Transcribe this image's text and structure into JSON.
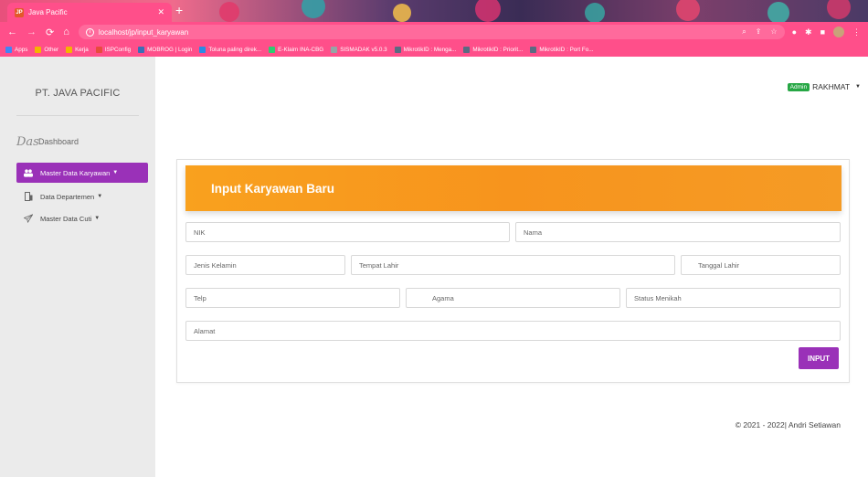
{
  "browser": {
    "tab_title": "Java Pacific",
    "tab_favicon_text": "JP",
    "url": "localhost/jp/input_karyawan",
    "bookmarks": [
      {
        "label": "Apps",
        "color": "#4285f4"
      },
      {
        "label": "Other",
        "color": "#f4b400"
      },
      {
        "label": "Kerja",
        "color": "#f4b400"
      },
      {
        "label": "ISPConfig",
        "color": "#e74c3c"
      },
      {
        "label": "MOBROG | Login",
        "color": "#3b6fb6"
      },
      {
        "label": "Toluna paling direk...",
        "color": "#2b8be5"
      },
      {
        "label": "E-Klaim INA-CBG",
        "color": "#2ecc71"
      },
      {
        "label": "SISMADAK v5.0.3",
        "color": "#95a5a6"
      },
      {
        "label": "MikrotikID : Menga...",
        "color": "#5a6b82"
      },
      {
        "label": "MikrotikID : Priorit...",
        "color": "#5a6b82"
      },
      {
        "label": "MikrotikID : Port Fo...",
        "color": "#5a6b82"
      }
    ]
  },
  "sidebar": {
    "brand": "PT. JAVA PACIFIC",
    "dashboard_italic": "Das",
    "dashboard_label": "Dashboard",
    "items": [
      {
        "label": "Master Data Karyawan",
        "icon": "users-icon",
        "active": true
      },
      {
        "label": "Data Departemen",
        "icon": "building-icon",
        "active": false
      },
      {
        "label": "Master Data Cuti",
        "icon": "paper-plane-icon",
        "active": false
      }
    ]
  },
  "user": {
    "role_badge": "Admin",
    "name": "RAKHMAT"
  },
  "form": {
    "title": "Input Karyawan Baru",
    "placeholders": {
      "nik": "NIK",
      "nama": "Nama",
      "jenis_kelamin": "Jenis Kelamin",
      "tempat_lahir": "Tempat Lahir",
      "tanggal_lahir": "Tanggal Lahir",
      "telp": "Telp",
      "agama": "Agama",
      "status_menikah": "Status Menikah",
      "alamat": "Alamat"
    },
    "submit_label": "INPUT"
  },
  "footer": {
    "text": "© 2021 - 2022| Andri Setiawan"
  },
  "colors": {
    "accent_purple": "#9a31b8",
    "header_orange": "#f7941d",
    "browser_pink": "#ff4f8a",
    "admin_green": "#27a745"
  }
}
